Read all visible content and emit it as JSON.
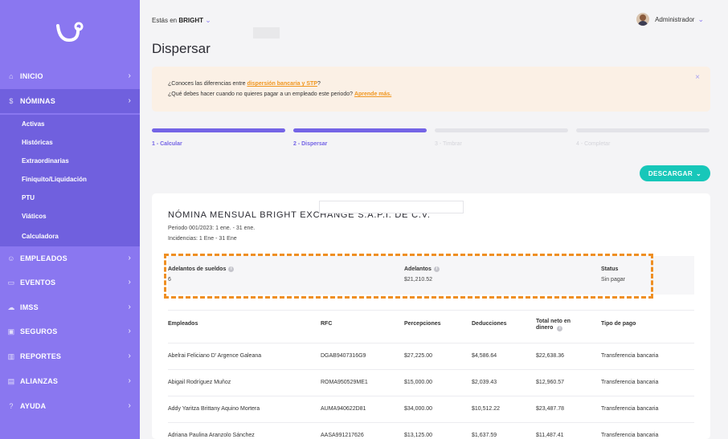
{
  "sidebar": {
    "items": [
      {
        "label": "INICIO",
        "icon": "home-icon"
      },
      {
        "label": "NÓMINAS",
        "icon": "dollar-icon"
      },
      {
        "label": "EMPLEADOS",
        "icon": "user-icon"
      },
      {
        "label": "EVENTOS",
        "icon": "calendar-icon"
      },
      {
        "label": "IMSS",
        "icon": "cloud-icon"
      },
      {
        "label": "SEGUROS",
        "icon": "briefcase-icon"
      },
      {
        "label": "REPORTES",
        "icon": "bar-chart-icon"
      },
      {
        "label": "ALIANZAS",
        "icon": "gift-icon"
      },
      {
        "label": "AYUDA",
        "icon": "help-icon"
      }
    ],
    "subitems": [
      "Activas",
      "Históricas",
      "Extraordinarias",
      "Finiquito/Liquidación",
      "PTU",
      "Viáticos",
      "Calculadora"
    ]
  },
  "header": {
    "company_prefix": "Estás en",
    "company_name": "BRIGHT",
    "user_name": "Administrador",
    "title": "Dispersar"
  },
  "info": {
    "line1_pre": "¿Conoces las diferencias entre ",
    "line1_link": "dispersión bancaria y STP",
    "line1_post": "?",
    "line2_pre": "¿Qué debes hacer cuando no quieres pagar a un empleado este periodo? ",
    "line2_link": "Aprende más."
  },
  "steps": [
    {
      "label": "1 - Calcular",
      "done": true
    },
    {
      "label": "2 - Dispersar",
      "done": true
    },
    {
      "label": "3 - Timbrar",
      "done": false
    },
    {
      "label": "4 - Completar",
      "done": false
    }
  ],
  "download_label": "DESCARGAR",
  "card": {
    "title": "NÓMINA MENSUAL BRIGHT EXCHANGE S.A.P.I. DE C.V.",
    "period": "Periodo 001/2023: 1 ene. - 31 ene.",
    "incidencias": "Incidencias: 1 Ene - 31 Ene"
  },
  "summary": {
    "adelantos_sueldos_label": "Adelantos de sueldos",
    "adelantos_sueldos_value": "6",
    "adelantos_label": "Adelantos",
    "adelantos_value": "$21,210.52",
    "status_label": "Status",
    "status_value": "Sin pagar"
  },
  "table": {
    "headers": [
      "Empleados",
      "RFC",
      "Percepciones",
      "Deducciones",
      "Total neto en dinero",
      "Tipo de pago"
    ],
    "rows": [
      [
        "Abelrai Feliciano D' Argence Galeana",
        "DGAB9407316G9",
        "$27,225.00",
        "$4,586.64",
        "$22,638.36",
        "Transferencia bancaria"
      ],
      [
        "Abigail Rodríguez Muñoz",
        "ROMA950529ME1",
        "$15,000.00",
        "$2,039.43",
        "$12,960.57",
        "Transferencia bancaria"
      ],
      [
        "Addy Yaritza Brittany Aquino Mortera",
        "AUMA940622D81",
        "$34,000.00",
        "$10,512.22",
        "$23,487.78",
        "Transferencia bancaria"
      ],
      [
        "Adriana Paulina Aranzolo Sánchez",
        "AASA991217626",
        "$13,125.00",
        "$1,637.59",
        "$11,487.41",
        "Transferencia bancaria"
      ]
    ]
  },
  "colors": {
    "sidebar": "#8a77f0",
    "accent": "#7464e6",
    "teal": "#17c7b9",
    "orange": "#ef8f23"
  }
}
